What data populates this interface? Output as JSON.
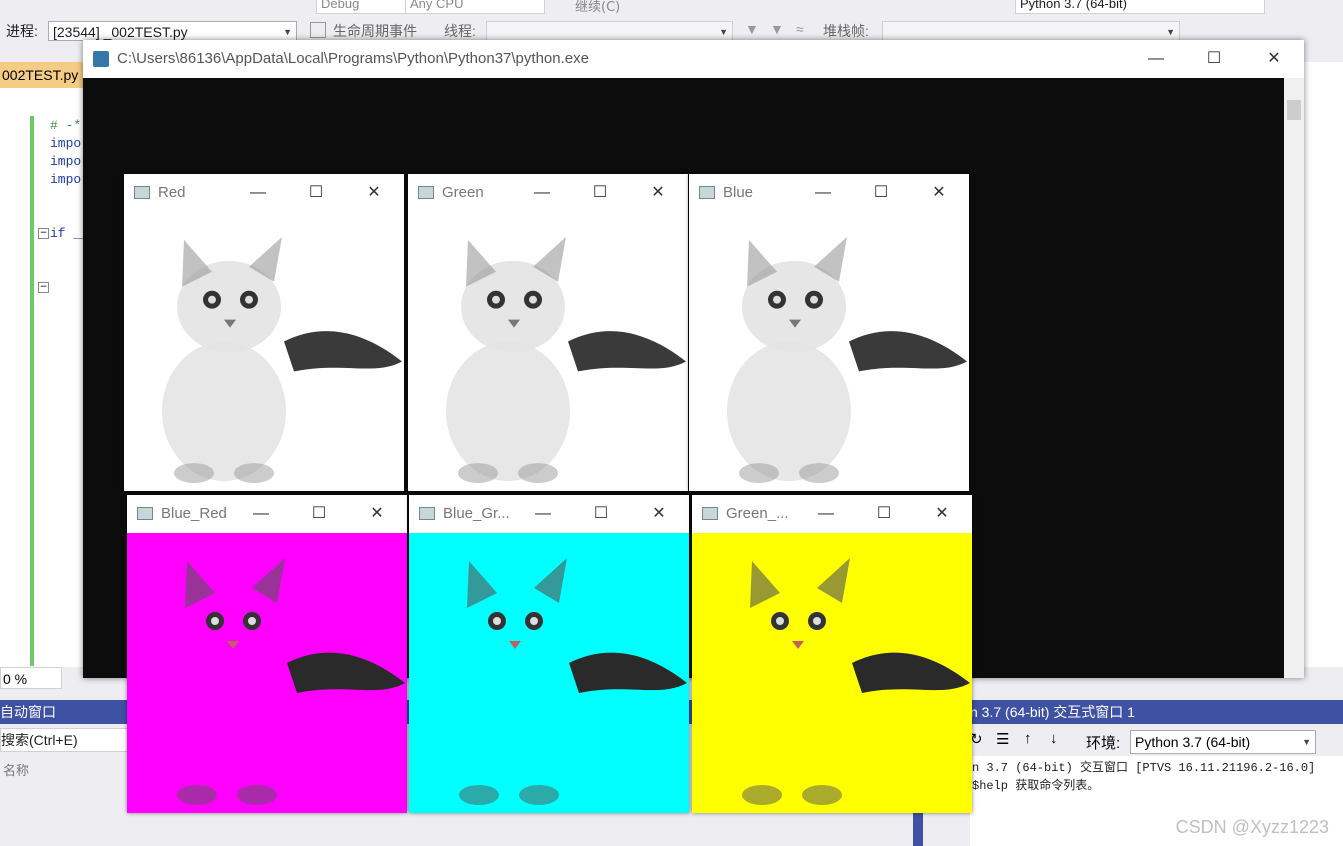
{
  "toolbar1": {
    "config": "Debug",
    "platform": "Any CPU",
    "continue": "继续(C)",
    "env": "Python 3.7 (64-bit)"
  },
  "toolbar2": {
    "process_label": "进程:",
    "process_value": "[23544] _002TEST.py",
    "lifecycle_label": "生命周期事件",
    "thread_label": "线程:",
    "stackframe_label": "堆栈帧:"
  },
  "editor": {
    "tab_label": "002TEST.py",
    "lines": [
      "# -*-",
      "impor",
      "impor",
      "impor",
      "if __"
    ]
  },
  "console": {
    "title": "C:\\Users\\86136\\AppData\\Local\\Programs\\Python\\Python37\\python.exe",
    "min": "—",
    "max": "☐",
    "close": "✕"
  },
  "windows": [
    {
      "title": "Red",
      "tint": "#ffffff"
    },
    {
      "title": "Green",
      "tint": "#ffffff"
    },
    {
      "title": "Blue",
      "tint": "#ffffff"
    },
    {
      "title": "Blue_Red",
      "tint": "#ff00ff"
    },
    {
      "title": "Blue_Gr...",
      "tint": "#00ffff"
    },
    {
      "title": "Green_...",
      "tint": "#ffff00"
    }
  ],
  "bottom": {
    "zoom": "0 %",
    "auto_window": "自动窗口",
    "search": "搜索(Ctrl+E)",
    "name_col": "名称",
    "interactive_title": "n 3.7 (64-bit) 交互式窗口 1",
    "env_label": "环境:",
    "env_value": "Python 3.7 (64-bit)",
    "line1": "n 3.7 (64-bit) 交互窗口 [PTVS 16.11.21196.2-16.0]",
    "line2": "$help 获取命令列表。"
  },
  "watermark": "CSDN @Xyzz1223"
}
